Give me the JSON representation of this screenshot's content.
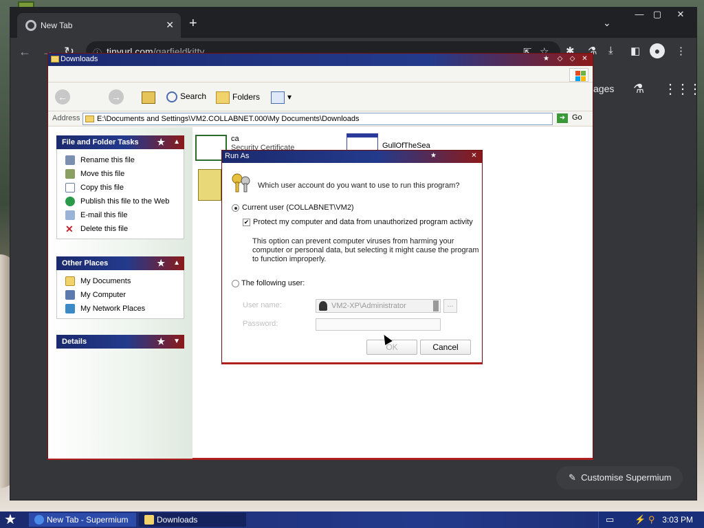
{
  "chrome": {
    "tab_title": "New Tab",
    "tab_close": "✕",
    "new_tab": "+",
    "tab_search": "⌄",
    "minimize": "—",
    "maximize": "▢",
    "close": "✕",
    "back": "←",
    "forward": "→",
    "reload": "↻",
    "url_host": "tinyurl.com",
    "url_path": "/garfieldkitty",
    "ntp_images": "ages",
    "customise_label": "Customise Supermium"
  },
  "explorer": {
    "title": "Downloads",
    "toolbar": {
      "back": "←",
      "forward": "→",
      "search": "Search",
      "folders": "Folders"
    },
    "address_label": "Address",
    "address_value": "E:\\Documents and Settings\\VM2.COLLABNET.000\\My Documents\\Downloads",
    "go": "Go",
    "panels": {
      "file_tasks": {
        "title": "File and Folder Tasks",
        "items": [
          "Rename this file",
          "Move this file",
          "Copy this file",
          "Publish this file to the Web",
          "E-mail this file",
          "Delete this file"
        ]
      },
      "other_places": {
        "title": "Other Places",
        "items": [
          "My Documents",
          "My Computer",
          "My Network Places"
        ]
      },
      "details": {
        "title": "Details"
      }
    },
    "files": [
      {
        "name": "ca",
        "type": "Security Certificate"
      },
      {
        "name": "GullOfTheSea",
        "type": ""
      }
    ]
  },
  "runas": {
    "title": "Run As",
    "close": "✕",
    "question": "Which user account do you want to use to run this program?",
    "current_user_label": "Current user (COLLABNET\\VM2)",
    "protect_label": "Protect my computer and data from unauthorized program activity",
    "description": "This option can prevent computer viruses from harming your computer or personal data, but selecting it might cause the program to function improperly.",
    "following_user_label": "The following user:",
    "user_name_label": "User name:",
    "user_name_value": "VM2-XP\\Administrator",
    "browse": "...",
    "password_label": "Password:",
    "ok": "OK",
    "cancel": "Cancel"
  },
  "taskbar": {
    "items": [
      "New Tab - Supermium",
      "Downloads"
    ],
    "clock": "3:03 PM"
  },
  "colors": {
    "xp_blue": "#233a8c",
    "xp_red": "#8b1a1a",
    "chrome_dark": "#202124"
  }
}
